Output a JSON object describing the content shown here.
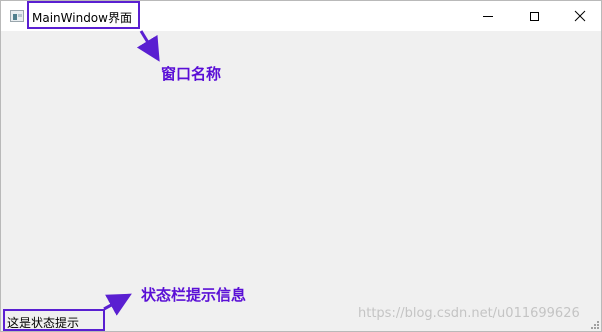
{
  "window": {
    "title": "MainWindow界面"
  },
  "titlebar_buttons": {
    "minimize_icon": "minimize-icon",
    "maximize_icon": "maximize-icon",
    "close_icon": "close-icon"
  },
  "annotations": {
    "title_label": "窗口名称",
    "status_label": "状态栏提示信息",
    "color": "#5a0fd6"
  },
  "statusbar": {
    "message": "这是状态提示"
  },
  "watermark": "https://blog.csdn.net/u011699626"
}
